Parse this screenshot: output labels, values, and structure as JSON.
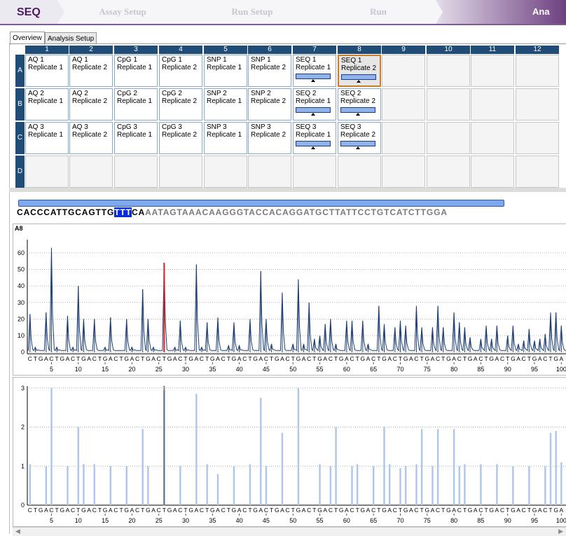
{
  "app_title": "SEQ",
  "steps": [
    {
      "label": "Assay Setup"
    },
    {
      "label": "Run Setup"
    },
    {
      "label": "Run"
    },
    {
      "label": "Ana"
    }
  ],
  "tabs": [
    {
      "label": "Overview"
    },
    {
      "label": "Analysis Setup"
    }
  ],
  "plate": {
    "columns": [
      "1",
      "2",
      "3",
      "4",
      "5",
      "6",
      "7",
      "8",
      "9",
      "10",
      "11",
      "12"
    ],
    "rows": [
      "A",
      "B",
      "C",
      "D"
    ],
    "wells": [
      [
        [
          "AQ 1",
          "Replicate 1"
        ],
        [
          "AQ 1",
          "Replicate 2"
        ],
        [
          "CpG 1",
          "Replicate 1"
        ],
        [
          "CpG 1",
          "Replicate 2"
        ],
        [
          "SNP 1",
          "Replicate 1"
        ],
        [
          "SNP 1",
          "Replicate 2"
        ],
        [
          "SEQ 1",
          "Replicate 1"
        ],
        [
          "SEQ 1",
          "Replicate 2"
        ]
      ],
      [
        [
          "AQ 2",
          "Replicate 1"
        ],
        [
          "AQ 2",
          "Replicate 2"
        ],
        [
          "CpG 2",
          "Replicate 1"
        ],
        [
          "CpG 2",
          "Replicate 2"
        ],
        [
          "SNP 2",
          "Replicate 1"
        ],
        [
          "SNP 2",
          "Replicate 2"
        ],
        [
          "SEQ 2",
          "Replicate 1"
        ],
        [
          "SEQ 2",
          "Replicate 2"
        ]
      ],
      [
        [
          "AQ 3",
          "Replicate 1"
        ],
        [
          "AQ 3",
          "Replicate 2"
        ],
        [
          "CpG 3",
          "Replicate 1"
        ],
        [
          "CpG 3",
          "Replicate 2"
        ],
        [
          "SNP 3",
          "Replicate 1"
        ],
        [
          "SNP 3",
          "Replicate 2"
        ],
        [
          "SEQ 3",
          "Replicate 1"
        ],
        [
          "SEQ 3",
          "Replicate 2"
        ]
      ],
      []
    ],
    "selected_well": "A8"
  },
  "sequence": {
    "before": "CACCCATTGCAGTTG",
    "highlight": "TTT",
    "after": "CA",
    "tail": "AATAGTAAACAAGGGTACCACAGGATGCTTATTCCTGTCATCTTGGA"
  },
  "chart_data": [
    {
      "type": "line",
      "title": "A8",
      "dispensation_order": "CTGA",
      "x_ticks": [
        5,
        10,
        15,
        20,
        25,
        30,
        35,
        40,
        45,
        50,
        55,
        60,
        65,
        70,
        75,
        80,
        85,
        90,
        95,
        100
      ],
      "yticks": [
        0,
        10,
        20,
        30,
        40,
        50,
        60
      ],
      "ylim": [
        -1,
        68
      ],
      "xlim": [
        0.5,
        101
      ],
      "highlight_position": 26,
      "highlight_color": "#d22020",
      "peaks": [
        {
          "x": 1,
          "y": 23
        },
        {
          "x": 2,
          "y": 3
        },
        {
          "x": 4,
          "y": 24
        },
        {
          "x": 5,
          "y": 63
        },
        {
          "x": 6,
          "y": 3
        },
        {
          "x": 8,
          "y": 22
        },
        {
          "x": 9,
          "y": 3
        },
        {
          "x": 10,
          "y": 40
        },
        {
          "x": 11,
          "y": 20
        },
        {
          "x": 13,
          "y": 20
        },
        {
          "x": 15,
          "y": 3
        },
        {
          "x": 16,
          "y": 21
        },
        {
          "x": 19,
          "y": 20
        },
        {
          "x": 20,
          "y": 3
        },
        {
          "x": 22,
          "y": 38
        },
        {
          "x": 23,
          "y": 20
        },
        {
          "x": 24,
          "y": 3
        },
        {
          "x": 26,
          "y": 54
        },
        {
          "x": 28,
          "y": 3
        },
        {
          "x": 29,
          "y": 19
        },
        {
          "x": 30,
          "y": 3
        },
        {
          "x": 32,
          "y": 53
        },
        {
          "x": 33,
          "y": 3
        },
        {
          "x": 34,
          "y": 18
        },
        {
          "x": 36,
          "y": 21
        },
        {
          "x": 38,
          "y": 4
        },
        {
          "x": 39,
          "y": 18
        },
        {
          "x": 40,
          "y": 4
        },
        {
          "x": 42,
          "y": 20
        },
        {
          "x": 44,
          "y": 49
        },
        {
          "x": 45,
          "y": 20
        },
        {
          "x": 46,
          "y": 5
        },
        {
          "x": 48,
          "y": 36
        },
        {
          "x": 50,
          "y": 5
        },
        {
          "x": 51,
          "y": 44
        },
        {
          "x": 52,
          "y": 5
        },
        {
          "x": 53,
          "y": 30
        },
        {
          "x": 54,
          "y": 8
        },
        {
          "x": 55,
          "y": 10
        },
        {
          "x": 56,
          "y": 17
        },
        {
          "x": 57,
          "y": 20
        },
        {
          "x": 58,
          "y": 5
        },
        {
          "x": 60,
          "y": 19
        },
        {
          "x": 61,
          "y": 19
        },
        {
          "x": 63,
          "y": 19
        },
        {
          "x": 64,
          "y": 5
        },
        {
          "x": 66,
          "y": 28
        },
        {
          "x": 67,
          "y": 17
        },
        {
          "x": 69,
          "y": 15
        },
        {
          "x": 70,
          "y": 19
        },
        {
          "x": 71,
          "y": 16
        },
        {
          "x": 73,
          "y": 28
        },
        {
          "x": 74,
          "y": 15
        },
        {
          "x": 76,
          "y": 15
        },
        {
          "x": 77,
          "y": 28
        },
        {
          "x": 78,
          "y": 15
        },
        {
          "x": 80,
          "y": 24
        },
        {
          "x": 81,
          "y": 18
        },
        {
          "x": 82,
          "y": 15
        },
        {
          "x": 83,
          "y": 9
        },
        {
          "x": 85,
          "y": 8
        },
        {
          "x": 86,
          "y": 16
        },
        {
          "x": 87,
          "y": 8
        },
        {
          "x": 88,
          "y": 16
        },
        {
          "x": 90,
          "y": 10
        },
        {
          "x": 91,
          "y": 16
        },
        {
          "x": 92,
          "y": 5
        },
        {
          "x": 93,
          "y": 7
        },
        {
          "x": 94,
          "y": 14
        },
        {
          "x": 95,
          "y": 7
        },
        {
          "x": 96,
          "y": 8
        },
        {
          "x": 97,
          "y": 11
        },
        {
          "x": 98,
          "y": 24
        },
        {
          "x": 99,
          "y": 24
        },
        {
          "x": 100,
          "y": 16
        }
      ]
    },
    {
      "type": "bar",
      "dispensation_order": "CTGA",
      "x_ticks": [
        5,
        10,
        15,
        20,
        25,
        30,
        35,
        40,
        45,
        50,
        55,
        60,
        65,
        70,
        75,
        80,
        85,
        90,
        95,
        100
      ],
      "yticks": [
        0,
        1,
        2,
        3
      ],
      "ylim": [
        0,
        3.05
      ],
      "xlim": [
        0.5,
        101
      ],
      "marker_position": 26,
      "bars": [
        {
          "x": 1,
          "y": 1.05
        },
        {
          "x": 4,
          "y": 1.0
        },
        {
          "x": 5,
          "y": 3.0
        },
        {
          "x": 8,
          "y": 1.0
        },
        {
          "x": 10,
          "y": 2.0
        },
        {
          "x": 11,
          "y": 1.05
        },
        {
          "x": 13,
          "y": 1.05
        },
        {
          "x": 16,
          "y": 1.0
        },
        {
          "x": 19,
          "y": 1.0
        },
        {
          "x": 22,
          "y": 1.95
        },
        {
          "x": 23,
          "y": 1.0
        },
        {
          "x": 26,
          "y": 2.95
        },
        {
          "x": 29,
          "y": 1.0
        },
        {
          "x": 32,
          "y": 2.85
        },
        {
          "x": 34,
          "y": 1.05
        },
        {
          "x": 36,
          "y": 0.8
        },
        {
          "x": 39,
          "y": 1.0
        },
        {
          "x": 42,
          "y": 1.05
        },
        {
          "x": 44,
          "y": 2.75
        },
        {
          "x": 45,
          "y": 1.0
        },
        {
          "x": 48,
          "y": 1.85
        },
        {
          "x": 51,
          "y": 3.0
        },
        {
          "x": 55,
          "y": 1.05
        },
        {
          "x": 57,
          "y": 1.0
        },
        {
          "x": 58,
          "y": 2.0
        },
        {
          "x": 61,
          "y": 1.0
        },
        {
          "x": 62,
          "y": 1.05
        },
        {
          "x": 65,
          "y": 1.0
        },
        {
          "x": 67,
          "y": 2.0
        },
        {
          "x": 68,
          "y": 1.05
        },
        {
          "x": 70,
          "y": 0.95
        },
        {
          "x": 71,
          "y": 1.0
        },
        {
          "x": 73,
          "y": 1.05
        },
        {
          "x": 74,
          "y": 1.95
        },
        {
          "x": 76,
          "y": 1.0
        },
        {
          "x": 77,
          "y": 1.95
        },
        {
          "x": 80,
          "y": 1.95
        },
        {
          "x": 81,
          "y": 1.0
        },
        {
          "x": 82,
          "y": 1.05
        },
        {
          "x": 85,
          "y": 1.05
        },
        {
          "x": 88,
          "y": 1.05
        },
        {
          "x": 91,
          "y": 1.0
        },
        {
          "x": 94,
          "y": 1.0
        },
        {
          "x": 97,
          "y": 1.0
        },
        {
          "x": 98,
          "y": 1.85
        },
        {
          "x": 99,
          "y": 1.9
        },
        {
          "x": 100,
          "y": 1.1
        }
      ]
    }
  ]
}
